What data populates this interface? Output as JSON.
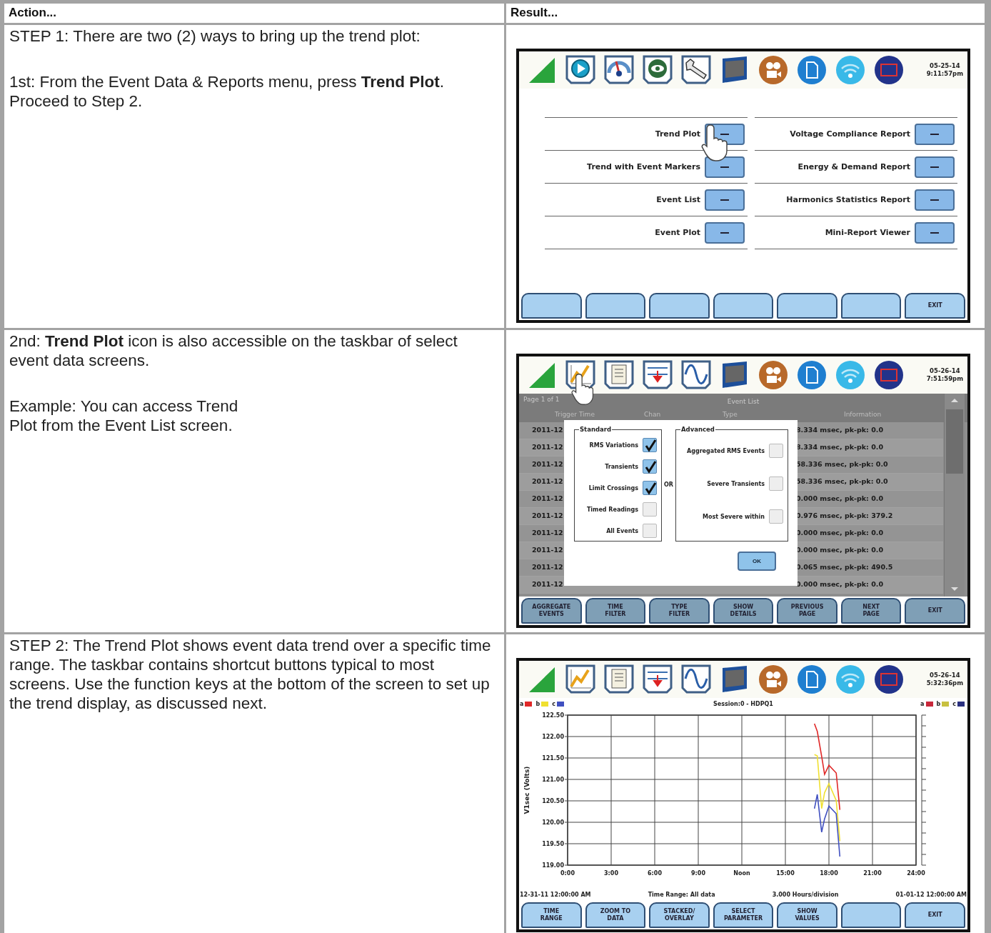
{
  "table": {
    "columns": [
      "Action...",
      "Result..."
    ],
    "rows": [
      {
        "action": [
          "STEP 1: There are two (2) ways to bring up the trend plot:",
          "1st: From the Event Data & Reports menu, press **Trend Plot**.\nProceed to Step 2."
        ],
        "screen": {
          "kind": "menu",
          "date": "05-25-14",
          "time": "9:11:57pm",
          "menu_left": [
            "Trend Plot",
            "Trend with Event Markers",
            "Event List",
            "Event Plot"
          ],
          "menu_right": [
            "Voltage Compliance Report",
            "Energy & Demand Report",
            "Harmonics Statistics Report",
            "Mini-Report Viewer"
          ],
          "keys": [
            {
              "kind": "blank"
            },
            {
              "kind": "blank"
            },
            {
              "kind": "blank"
            },
            {
              "kind": "blank"
            },
            {
              "kind": "blank"
            },
            {
              "kind": "blank"
            },
            {
              "kind": "label",
              "label": "EXIT"
            }
          ]
        }
      },
      {
        "action": [
          "2nd: **Trend Plot** icon is also accessible on the taskbar of select event data screens.",
          "Example: You can access Trend\nPlot from the Event List screen."
        ],
        "screen": {
          "kind": "event_list",
          "date": "05-26-14",
          "time": "7:51:59pm",
          "page": "Page 1 of 1",
          "list_title": "Event List",
          "columns": [
            "Trigger Time",
            "Chan",
            "Type",
            "Information"
          ],
          "rows": [
            {
              "time": "2011-12",
              "info": "8.334 msec, pk-pk: 0.0"
            },
            {
              "time": "2011-12",
              "info": "8.334 msec, pk-pk: 0.0"
            },
            {
              "time": "2011-12",
              "info": "58.336 msec, pk-pk: 0.0"
            },
            {
              "time": "2011-12",
              "info": "58.336 msec, pk-pk: 0.0"
            },
            {
              "time": "2011-12",
              "info": "0.000 msec, pk-pk: 0.0"
            },
            {
              "time": "2011-12",
              "info": "0.976 msec, pk-pk: 379.2"
            },
            {
              "time": "2011-12",
              "info": "0.000 msec, pk-pk: 0.0"
            },
            {
              "time": "2011-12",
              "info": "0.000 msec, pk-pk: 0.0"
            },
            {
              "time": "2011-12",
              "info": "0.065 msec, pk-pk: 490.5"
            },
            {
              "time": "2011-12",
              "info": "0.000 msec, pk-pk: 0.0"
            }
          ],
          "dialog": {
            "standard_title": "Standard",
            "standard": [
              {
                "label": "RMS Variations",
                "checked": true
              },
              {
                "label": "Transients",
                "checked": true
              },
              {
                "label": "Limit Crossings",
                "checked": true
              },
              {
                "label": "Timed Readings",
                "checked": false
              },
              {
                "label": "All Events",
                "checked": false
              }
            ],
            "or": "OR",
            "advanced_title": "Advanced",
            "advanced": [
              {
                "label": "Aggregated RMS Events",
                "checked": false
              },
              {
                "label": "Severe Transients",
                "checked": false
              },
              {
                "label": "Most Severe within",
                "checked": false
              }
            ],
            "ok": "OK"
          },
          "keys": [
            {
              "kind": "label",
              "label": "AGGREGATE\nEVENTS"
            },
            {
              "kind": "label",
              "label": "TIME\nFILTER"
            },
            {
              "kind": "label",
              "label": "TYPE\nFILTER"
            },
            {
              "kind": "label",
              "label": "SHOW\nDETAILS"
            },
            {
              "kind": "label",
              "label": "PREVIOUS\nPAGE"
            },
            {
              "kind": "label",
              "label": "NEXT\nPAGE"
            },
            {
              "kind": "label",
              "label": "EXIT"
            }
          ]
        }
      },
      {
        "action": [
          "STEP 2: The Trend Plot shows event data trend over a specific time range. The taskbar contains shortcut buttons typical to most screens. Use the function keys at the bottom of the screen to set up the trend display, as discussed next."
        ],
        "screen": {
          "kind": "trend",
          "date": "05-26-14",
          "time": "5:32:36pm",
          "legend_right": [
            {
              "label": "a",
              "color": "#c8283a"
            },
            {
              "label": "b",
              "color": "#c8c040"
            },
            {
              "label": "c",
              "color": "#2a3080"
            }
          ],
          "chart_data": {
            "type": "line",
            "title": "Session:0 - HDPQ1",
            "ylabel": "V1sec (Volts)",
            "grid": true,
            "legend": true,
            "x": [
              17.0,
              17.2,
              17.5,
              17.7,
              18.0,
              18.5,
              18.75
            ],
            "series": [
              {
                "name": "a",
                "color": "#e02828",
                "values": [
                  122.3,
                  122.12,
                  121.54,
                  121.12,
                  121.33,
                  121.15,
                  120.29
                ]
              },
              {
                "name": "b",
                "color": "#f0e030",
                "values": [
                  121.58,
                  121.55,
                  120.32,
                  120.69,
                  120.9,
                  120.51,
                  119.56
                ]
              },
              {
                "name": "c",
                "color": "#4050c0",
                "values": [
                  120.32,
                  120.65,
                  119.77,
                  120.08,
                  120.38,
                  120.2,
                  119.2
                ]
              }
            ],
            "xlim": [
              0,
              24
            ],
            "ylim": [
              119,
              122.5
            ],
            "xticks": [
              {
                "value": 0,
                "label": "0:00"
              },
              {
                "value": 3,
                "label": "3:00"
              },
              {
                "value": 6,
                "label": "6:00"
              },
              {
                "value": 9,
                "label": "9:00"
              },
              {
                "value": 12,
                "label": "Noon"
              },
              {
                "value": 15,
                "label": "15:00"
              },
              {
                "value": 18,
                "label": "18:00"
              },
              {
                "value": 21,
                "label": "21:00"
              },
              {
                "value": 24,
                "label": "24:00"
              }
            ],
            "yticks": [
              {
                "value": 119,
                "label": "119.00"
              },
              {
                "value": 119.5,
                "label": "119.50"
              },
              {
                "value": 120,
                "label": "120.00"
              },
              {
                "value": 120.5,
                "label": "120.50"
              },
              {
                "value": 121,
                "label": "121.00"
              },
              {
                "value": 121.5,
                "label": "121.50"
              },
              {
                "value": 122,
                "label": "122.00"
              },
              {
                "value": 122.5,
                "label": "122.50"
              }
            ]
          },
          "info": [
            "12-31-11 12:00:00 AM",
            "Time Range: All data",
            "3.000 Hours/division",
            "01-01-12 12:00:00 AM"
          ],
          "keys": [
            {
              "kind": "label",
              "label": "TIME\nRANGE"
            },
            {
              "kind": "label",
              "label": "ZOOM TO\nDATA"
            },
            {
              "kind": "label",
              "label": "STACKED/\nOVERLAY"
            },
            {
              "kind": "label",
              "label": "SELECT\nPARAMETER"
            },
            {
              "kind": "label",
              "label": "SHOW\nVALUES"
            },
            {
              "kind": "blank"
            },
            {
              "kind": "label",
              "label": "EXIT"
            }
          ]
        }
      }
    ]
  }
}
